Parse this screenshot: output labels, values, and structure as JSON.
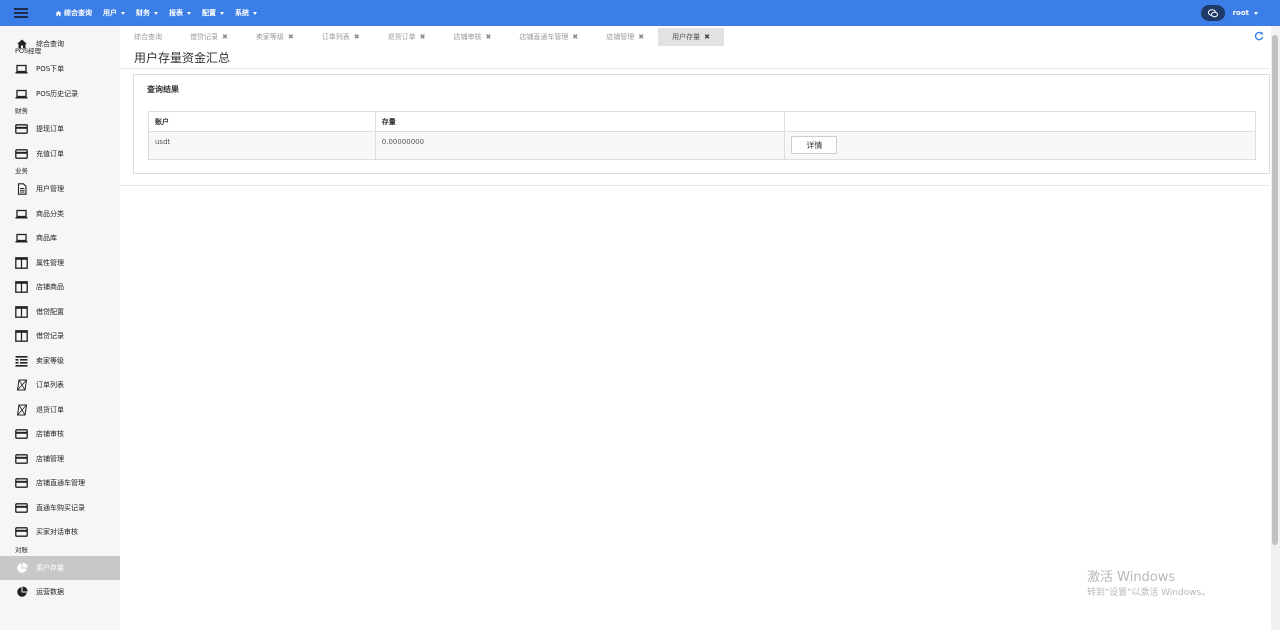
{
  "topbar": {
    "nav": [
      {
        "label": "综合查询",
        "icon": "home-icon",
        "caret": false
      },
      {
        "label": "用户",
        "caret": true
      },
      {
        "label": "财务",
        "caret": true
      },
      {
        "label": "报表",
        "caret": true
      },
      {
        "label": "配置",
        "caret": true
      },
      {
        "label": "系统",
        "caret": true
      }
    ],
    "user": "root",
    "colors": {
      "bar": "#3c7ee8",
      "chat_btn": "#1f3a66"
    }
  },
  "sidebar": {
    "items": [
      {
        "label": "综合查询",
        "icon": "home-icon"
      },
      {
        "section": "POS经理"
      },
      {
        "label": "POS下单",
        "icon": "laptop-icon"
      },
      {
        "label": "POS历史记录",
        "icon": "laptop-icon"
      },
      {
        "section": "财务"
      },
      {
        "label": "提现订单",
        "icon": "card-icon"
      },
      {
        "label": "充值订单",
        "icon": "card-icon"
      },
      {
        "section": "业务"
      },
      {
        "label": "用户管理",
        "icon": "document-icon"
      },
      {
        "label": "商品分类",
        "icon": "laptop-icon"
      },
      {
        "label": "商品库",
        "icon": "laptop-icon"
      },
      {
        "label": "属性管理",
        "icon": "columns-icon"
      },
      {
        "label": "店铺商品",
        "icon": "columns-icon"
      },
      {
        "label": "借贷配置",
        "icon": "columns-icon"
      },
      {
        "label": "借贷记录",
        "icon": "columns-icon"
      },
      {
        "label": "卖家等级",
        "icon": "list-icon"
      },
      {
        "label": "订单列表",
        "icon": "tag-icon"
      },
      {
        "label": "退货订单",
        "icon": "tag-icon"
      },
      {
        "label": "店铺审核",
        "icon": "card-icon"
      },
      {
        "label": "店铺管理",
        "icon": "card-icon"
      },
      {
        "label": "店铺直通车管理",
        "icon": "card-icon"
      },
      {
        "label": "直通车购买记录",
        "icon": "card-icon"
      },
      {
        "label": "买家对话审核",
        "icon": "card-icon"
      },
      {
        "section": "对账"
      },
      {
        "label": "用户存量",
        "icon": "pie-chart-icon",
        "active": true
      },
      {
        "label": "运营数据",
        "icon": "pie-chart-icon"
      }
    ]
  },
  "tabs": [
    {
      "label": "综合查询",
      "closable": false
    },
    {
      "label": "借贷记录",
      "closable": true
    },
    {
      "label": "卖家等级",
      "closable": true
    },
    {
      "label": "订单列表",
      "closable": true
    },
    {
      "label": "退货订单",
      "closable": true
    },
    {
      "label": "店铺审核",
      "closable": true
    },
    {
      "label": "店铺直通车管理",
      "closable": true
    },
    {
      "label": "店铺管理",
      "closable": true
    },
    {
      "label": "用户存量",
      "closable": true,
      "active": true
    }
  ],
  "tab_close_glyph": "✖",
  "page": {
    "title": "用户存量资金汇总",
    "panel_title": "查询结果",
    "table": {
      "headers": [
        "账户",
        "存量",
        ""
      ],
      "rows": [
        {
          "account": "usdt",
          "amount": "0.00000000",
          "action": "详情"
        }
      ]
    }
  },
  "watermark": {
    "line1": "激活 Windows",
    "line2": "转到\"设置\"以激活 Windows。"
  }
}
